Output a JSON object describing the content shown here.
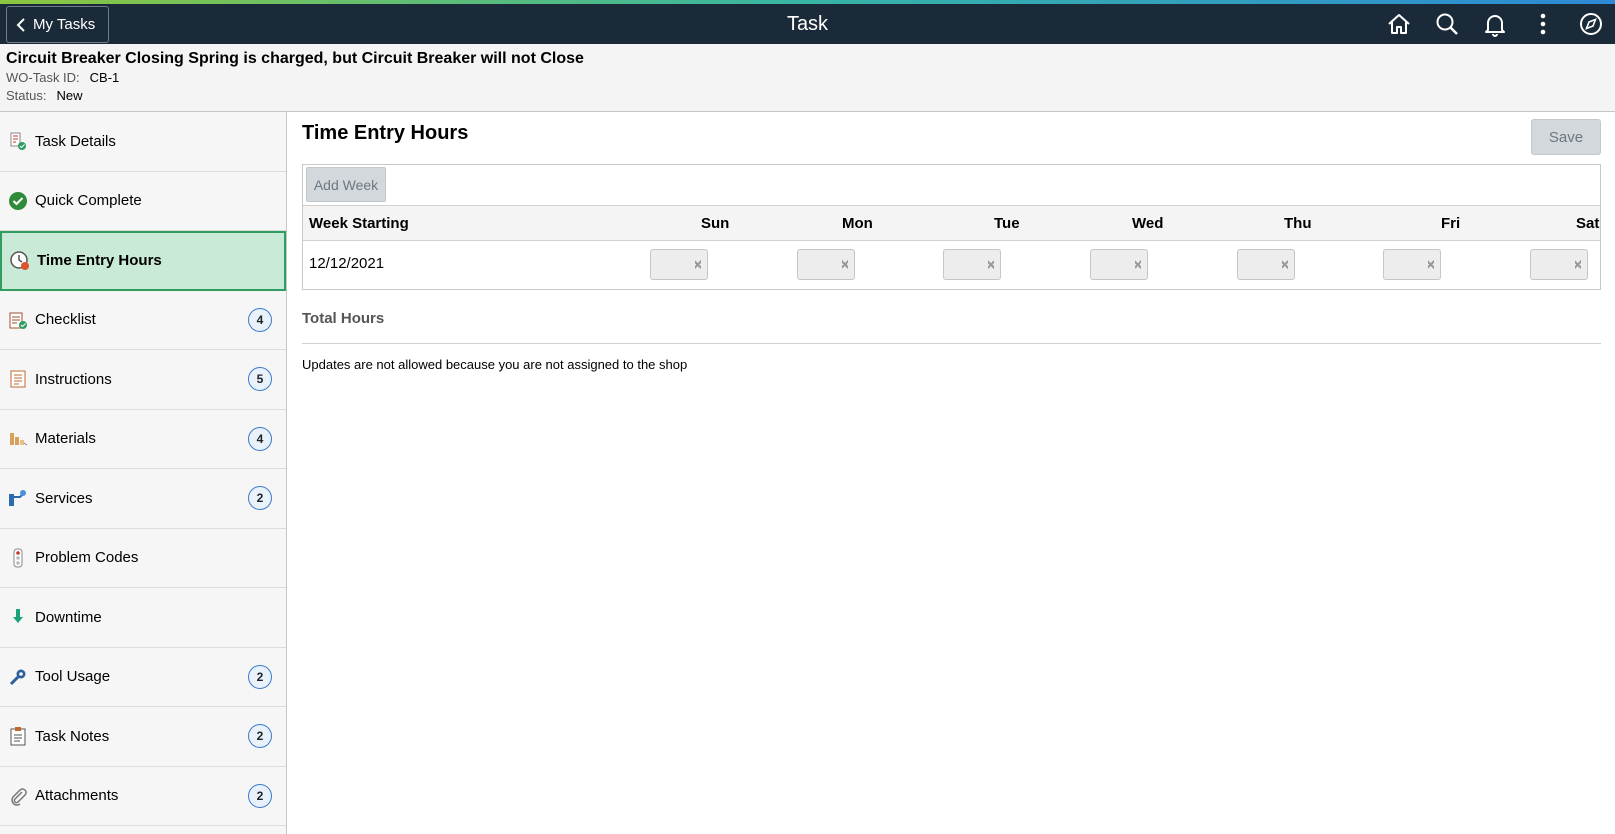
{
  "topbar": {
    "back_label": "My Tasks",
    "title": "Task",
    "icons": [
      "home-icon",
      "search-icon",
      "bell-icon",
      "more-vertical-icon",
      "compass-icon"
    ]
  },
  "header": {
    "task_title": "Circuit Breaker Closing Spring is charged, but Circuit Breaker will not Close",
    "wo_label": "WO-Task ID:",
    "wo_value": "CB-1",
    "status_label": "Status:",
    "status_value": "New"
  },
  "sidebar": {
    "items": [
      {
        "label": "Task Details",
        "icon": "task-details-icon",
        "badge": ""
      },
      {
        "label": "Quick Complete",
        "icon": "check-circle-icon",
        "badge": ""
      },
      {
        "label": "Time Entry Hours",
        "icon": "clock-icon",
        "badge": "",
        "active": true
      },
      {
        "label": "Checklist",
        "icon": "checklist-icon",
        "badge": "4"
      },
      {
        "label": "Instructions",
        "icon": "instructions-icon",
        "badge": "5"
      },
      {
        "label": "Materials",
        "icon": "materials-icon",
        "badge": "4"
      },
      {
        "label": "Services",
        "icon": "services-icon",
        "badge": "2"
      },
      {
        "label": "Problem Codes",
        "icon": "traffic-light-icon",
        "badge": ""
      },
      {
        "label": "Downtime",
        "icon": "down-arrow-icon",
        "badge": ""
      },
      {
        "label": "Tool Usage",
        "icon": "wrench-icon",
        "badge": "2"
      },
      {
        "label": "Task Notes",
        "icon": "notes-icon",
        "badge": "2"
      },
      {
        "label": "Attachments",
        "icon": "paperclip-icon",
        "badge": "2"
      }
    ]
  },
  "main": {
    "title": "Time Entry Hours",
    "save_label": "Save",
    "add_week_label": "Add Week",
    "columns": [
      "Week Starting",
      "Sun",
      "Mon",
      "Tue",
      "Wed",
      "Thu",
      "Fri",
      "Sat"
    ],
    "rows": [
      {
        "week_starting": "12/12/2021",
        "hours": [
          "",
          "",
          "",
          "",
          "",
          "",
          ""
        ]
      }
    ],
    "total_label": "Total Hours",
    "notice": "Updates are not allowed because you are not assigned to the shop"
  },
  "colors": {
    "topbar_bg": "#1b2a38",
    "active_item_bg": "#c9ead7",
    "active_item_border": "#2f9d5f",
    "badge_border": "#3a7bc8"
  }
}
